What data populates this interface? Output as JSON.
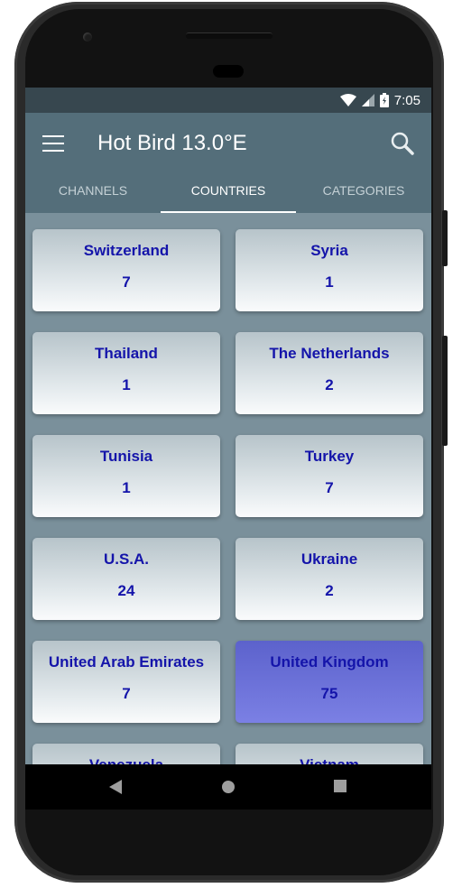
{
  "status_bar": {
    "time": "7:05",
    "icons": [
      "wifi-icon",
      "signal-icon",
      "battery-charging-icon"
    ]
  },
  "app_bar": {
    "title": "Hot Bird 13.0°E",
    "menu_icon": "hamburger-menu-icon",
    "search_icon": "search-icon"
  },
  "tabs": [
    {
      "label": "CHANNELS",
      "active": false
    },
    {
      "label": "COUNTRIES",
      "active": true
    },
    {
      "label": "CATEGORIES",
      "active": false
    }
  ],
  "countries": [
    {
      "name": "Switzerland",
      "count": "7"
    },
    {
      "name": "Syria",
      "count": "1"
    },
    {
      "name": "Thailand",
      "count": "1"
    },
    {
      "name": "The Netherlands",
      "count": "2"
    },
    {
      "name": "Tunisia",
      "count": "1"
    },
    {
      "name": "Turkey",
      "count": "7"
    },
    {
      "name": "U.S.A.",
      "count": "24"
    },
    {
      "name": "Ukraine",
      "count": "2"
    },
    {
      "name": "United Arab Emirates",
      "count": "7"
    },
    {
      "name": "United Kingdom",
      "count": "75",
      "selected": true
    },
    {
      "name": "Venezuela",
      "count": ""
    },
    {
      "name": "Vietnam",
      "count": ""
    }
  ],
  "nav_bar": {
    "back": "back-icon",
    "home": "home-icon",
    "recents": "recents-icon"
  },
  "colors": {
    "app_bar": "#546e7a",
    "status_bar": "#37474f",
    "card_text": "#1414aa",
    "selected_card": "#6a70d8"
  }
}
